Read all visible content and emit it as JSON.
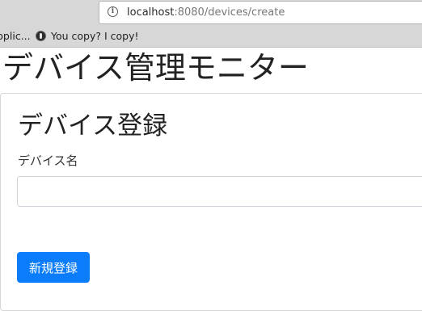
{
  "browser": {
    "url_host": "localhost",
    "url_path": ":8080/devices/create",
    "bookmarks": [
      {
        "label": "pplic..."
      },
      {
        "label": "You copy? I copy!",
        "icon": "circle-logo-icon"
      }
    ]
  },
  "header": {
    "title": "デバイス管理モニター"
  },
  "form": {
    "title": "デバイス登録",
    "name_label": "デバイス名",
    "name_value": "",
    "submit_label": "新規登録"
  },
  "colors": {
    "primary_button": "#0b7dfb",
    "chrome_background": "#d7d7d7"
  }
}
